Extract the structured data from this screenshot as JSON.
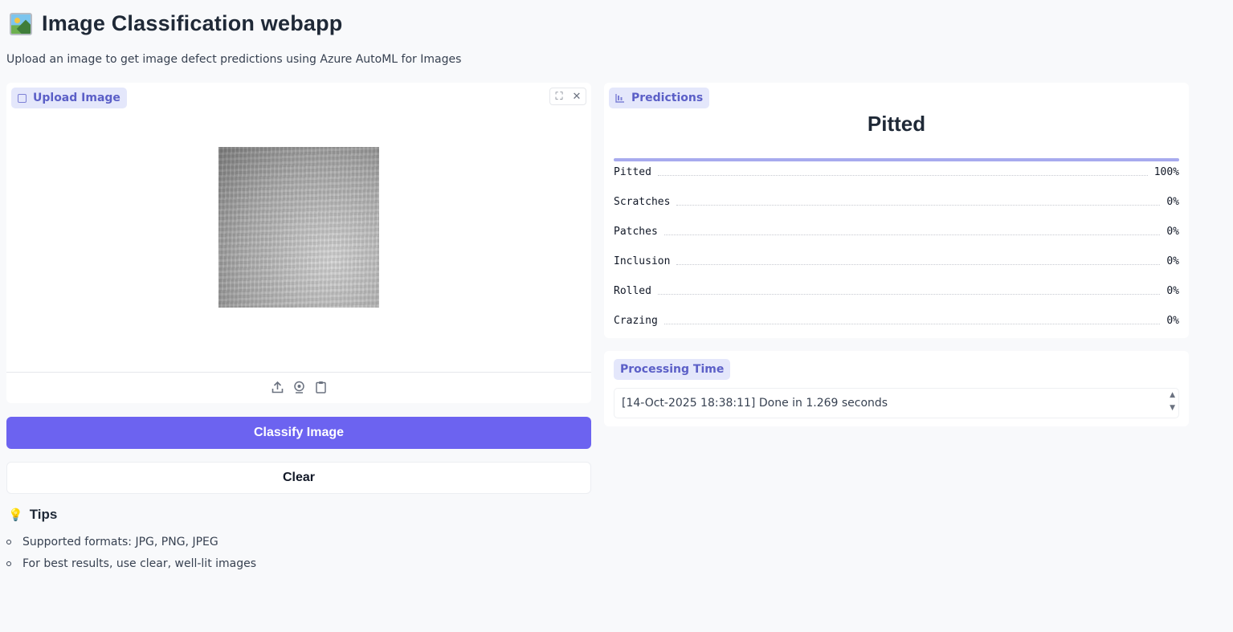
{
  "app": {
    "title": "Image Classification webapp",
    "subtitle": "Upload an image to get image defect predictions using Azure AutoML for Images"
  },
  "upload": {
    "label": "Upload Image",
    "fullscreen_icon": "fullscreen-icon",
    "close_icon": "close-icon",
    "sources": [
      "upload-icon",
      "webcam-icon",
      "clipboard-icon"
    ]
  },
  "buttons": {
    "classify": "Classify Image",
    "clear": "Clear"
  },
  "tips": {
    "heading": "Tips",
    "items": [
      "Supported formats: JPG, PNG, JPEG",
      "For best results, use clear, well-lit images"
    ]
  },
  "predictions": {
    "label": "Predictions",
    "top_label": "Pitted",
    "top_confidence": 1.0,
    "classes": [
      {
        "name": "Pitted",
        "value": "100%"
      },
      {
        "name": "Scratches",
        "value": "0%"
      },
      {
        "name": "Patches",
        "value": "0%"
      },
      {
        "name": "Inclusion",
        "value": "0%"
      },
      {
        "name": "Rolled",
        "value": "0%"
      },
      {
        "name": "Crazing",
        "value": "0%"
      }
    ]
  },
  "processing": {
    "label": "Processing Time",
    "text": "[14-Oct-2025 18:38:11] Done in 1.269 seconds"
  },
  "colors": {
    "accent": "#6c63f0",
    "label_bg": "#e4e7fb",
    "label_text": "#5b5fc7"
  }
}
